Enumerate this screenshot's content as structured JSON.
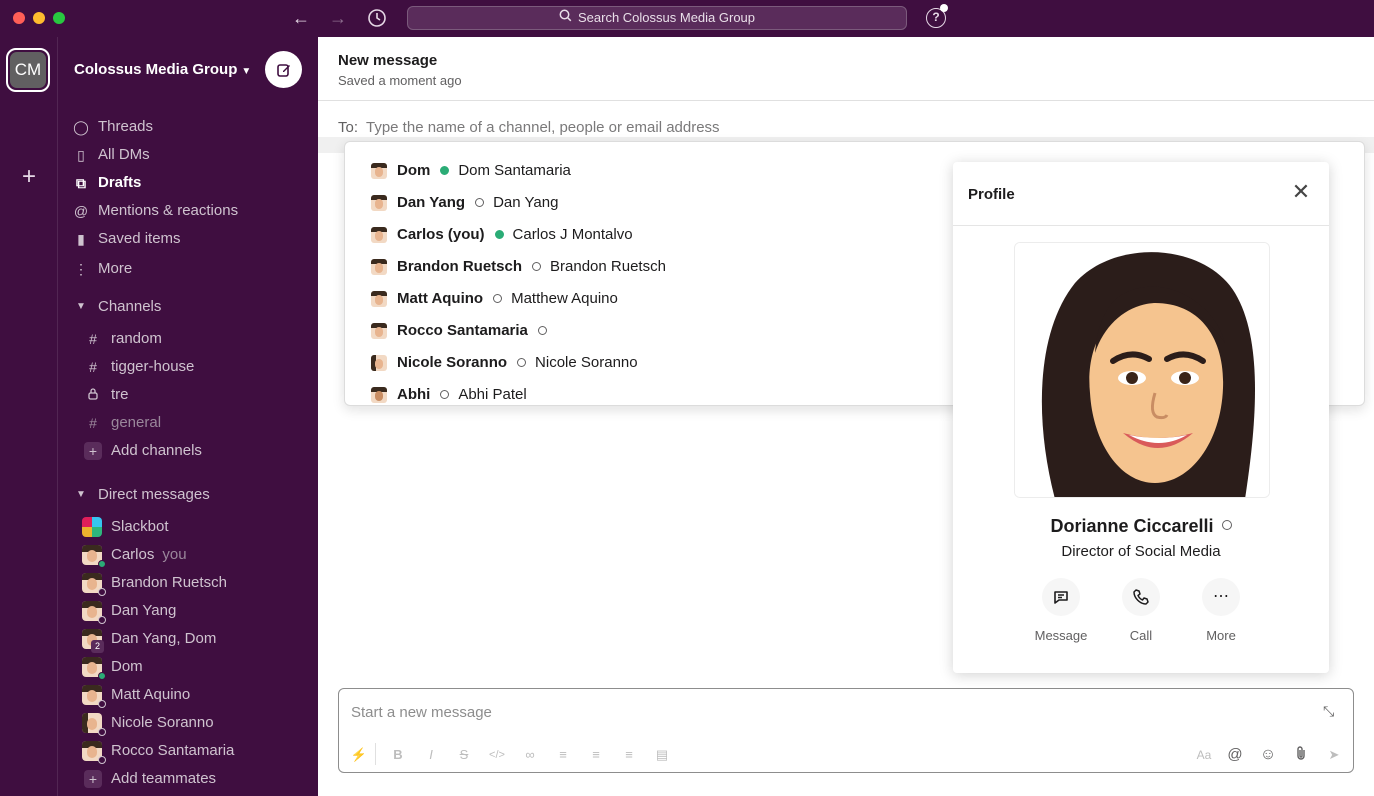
{
  "titlebar": {
    "search_placeholder": "Search Colossus Media Group",
    "help": "?"
  },
  "rail": {
    "workspace_initials": "CM",
    "add": "+"
  },
  "sidebar": {
    "workspace_name": "Colossus Media Group",
    "nav": [
      {
        "label": "Threads",
        "icon": "threads-icon"
      },
      {
        "label": "All DMs",
        "icon": "dms-icon"
      },
      {
        "label": "Drafts",
        "icon": "drafts-icon",
        "active": true
      },
      {
        "label": "Mentions & reactions",
        "icon": "at-icon"
      },
      {
        "label": "Saved items",
        "icon": "bookmark-icon"
      },
      {
        "label": "More",
        "icon": "more-vertical-icon"
      }
    ],
    "channels_header": "Channels",
    "channels": [
      {
        "label": "random",
        "icon": "#"
      },
      {
        "label": "tigger-house",
        "icon": "#"
      },
      {
        "label": "tre",
        "icon": "lock"
      },
      {
        "label": "general",
        "icon": "#",
        "muted": true
      }
    ],
    "add_channels": "Add channels",
    "dms_header": "Direct messages",
    "dms": [
      {
        "label": "Slackbot"
      },
      {
        "label": "Carlos",
        "suffix": "you",
        "online": true
      },
      {
        "label": "Brandon Ruetsch"
      },
      {
        "label": "Dan Yang"
      },
      {
        "label": "Dan Yang, Dom",
        "count": "2"
      },
      {
        "label": "Dom",
        "online": true
      },
      {
        "label": "Matt Aquino"
      },
      {
        "label": "Nicole Soranno"
      },
      {
        "label": "Rocco Santamaria"
      }
    ],
    "add_teammates": "Add teammates"
  },
  "main": {
    "title": "New message",
    "subtitle": "Saved a moment ago",
    "to_label": "To:",
    "to_placeholder": "Type the name of a channel, people or email address"
  },
  "suggestions": [
    {
      "display": "Dom",
      "full": "Dom Santamaria",
      "online": true
    },
    {
      "display": "Dan Yang",
      "full": "Dan Yang",
      "online": false
    },
    {
      "display": "Carlos (you)",
      "full": "Carlos J Montalvo",
      "online": true
    },
    {
      "display": "Brandon Ruetsch",
      "full": "Brandon Ruetsch",
      "online": false
    },
    {
      "display": "Matt Aquino",
      "full": "Matthew Aquino",
      "online": false
    },
    {
      "display": "Rocco Santamaria",
      "full": "",
      "online": false
    },
    {
      "display": "Nicole Soranno",
      "full": "Nicole Soranno",
      "online": false
    },
    {
      "display": "Abhi",
      "full": "Abhi Patel",
      "online": false
    }
  ],
  "profile": {
    "title": "Profile",
    "name": "Dorianne Ciccarelli",
    "role": "Director of Social Media",
    "actions": [
      {
        "label": "Message",
        "icon": "message-icon"
      },
      {
        "label": "Call",
        "icon": "phone-icon"
      },
      {
        "label": "More",
        "icon": "more-horizontal-icon"
      }
    ]
  },
  "composer": {
    "placeholder": "Start a new message"
  },
  "colors": {
    "aubergine": "#3f0e40",
    "presence_green": "#2bac76"
  }
}
